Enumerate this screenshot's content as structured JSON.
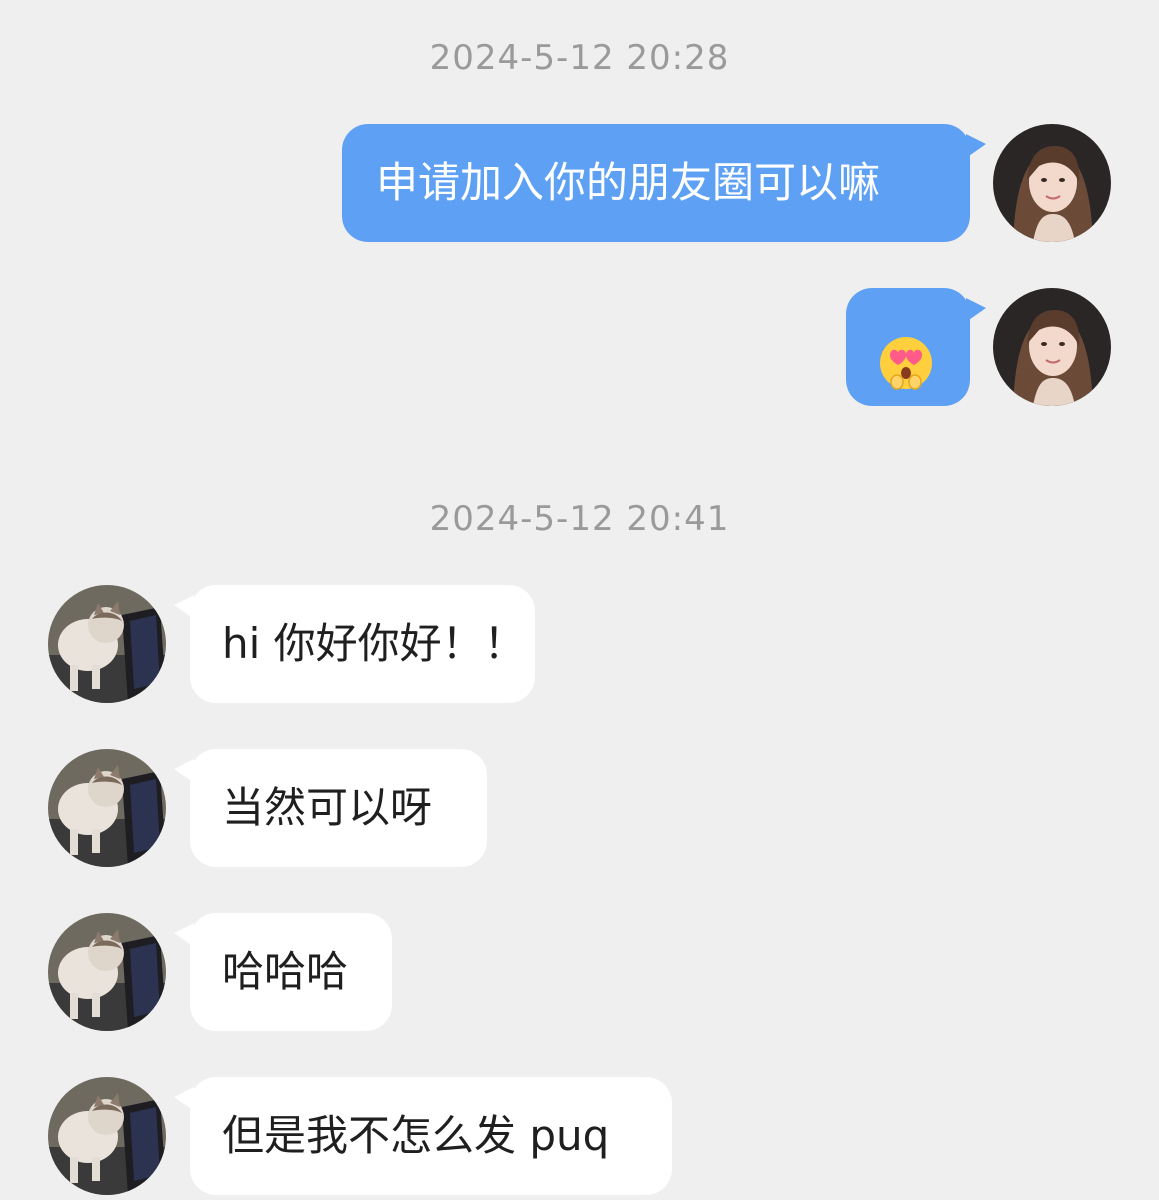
{
  "colors": {
    "background": "#efefef",
    "sent_bubble": "#5ea1f4",
    "received_bubble": "#ffffff",
    "timestamp_text": "#9a9a9a"
  },
  "timestamps": [
    "2024-5-12 20:28",
    "2024-5-12 20:41"
  ],
  "messages": [
    {
      "sender": "self",
      "type": "text",
      "text": "申请加入你的朋友圈可以嘛",
      "avatar_icon": "woman-avatar-icon"
    },
    {
      "sender": "self",
      "type": "emoji",
      "emoji_icon": "heart-eyes-emoji-icon",
      "avatar_icon": "woman-avatar-icon"
    },
    {
      "sender": "other",
      "type": "text",
      "text": "hi 你好你好！！",
      "avatar_icon": "cat-avatar-icon"
    },
    {
      "sender": "other",
      "type": "text",
      "text": "当然可以呀",
      "avatar_icon": "cat-avatar-icon"
    },
    {
      "sender": "other",
      "type": "text",
      "text": "哈哈哈",
      "avatar_icon": "cat-avatar-icon"
    },
    {
      "sender": "other",
      "type": "text",
      "text": "但是我不怎么发 puq",
      "avatar_icon": "cat-avatar-icon"
    }
  ]
}
